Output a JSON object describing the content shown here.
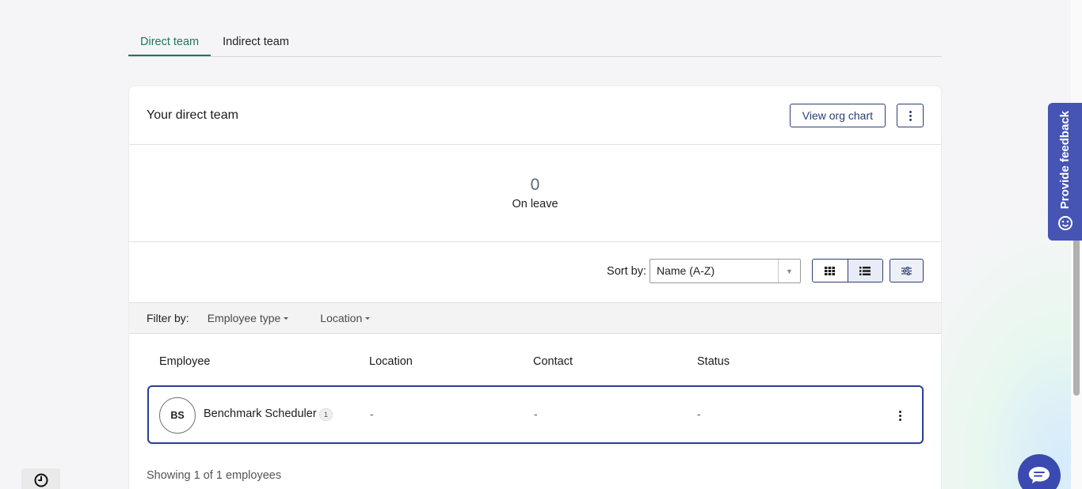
{
  "tabs": [
    {
      "label": "Direct team",
      "active": true
    },
    {
      "label": "Indirect team",
      "active": false
    }
  ],
  "card": {
    "title": "Your direct team",
    "view_org_chart_label": "View org chart"
  },
  "stats": {
    "on_leave_value": "0",
    "on_leave_label": "On leave"
  },
  "toolbar": {
    "sort_label": "Sort by:",
    "sort_value": "Name (A-Z)",
    "view_mode": "list"
  },
  "filters": {
    "label": "Filter by:",
    "items": [
      "Employee type",
      "Location"
    ]
  },
  "table": {
    "columns": [
      "Employee",
      "Location",
      "Contact",
      "Status"
    ],
    "rows": [
      {
        "initials": "BS",
        "name": "Benchmark Scheduler",
        "badge": "1",
        "location": "-",
        "contact": "-",
        "status": "-"
      }
    ]
  },
  "footer": {
    "showing": "Showing 1 of 1 employees"
  },
  "feedback": {
    "label": "Provide feedback"
  },
  "colors": {
    "accent_green": "#1a7a5a",
    "primary_navy": "#2c3e73",
    "feedback_bg": "#4654b3"
  },
  "icons": [
    "grid-icon",
    "list-icon",
    "sliders-icon",
    "kebab-icon",
    "smiley-icon",
    "chat-icon",
    "clock-icon"
  ]
}
